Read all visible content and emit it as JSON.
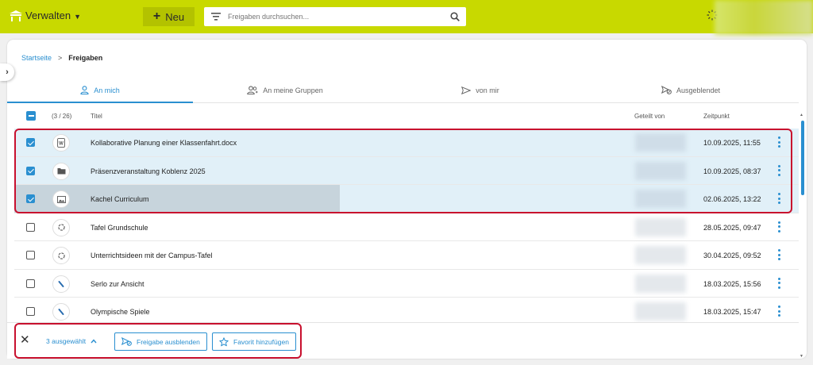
{
  "topbar": {
    "manage_label": "Verwalten",
    "new_label": "Neu",
    "search_placeholder": "Freigaben durchsuchen...",
    "colors": {
      "bar": "#c8d900",
      "new_button": "#b3c200"
    }
  },
  "breadcrumb": {
    "home": "Startseite",
    "current": "Freigaben"
  },
  "tabs": [
    {
      "label": "An mich",
      "icon": "person-icon",
      "active": true
    },
    {
      "label": "An meine Gruppen",
      "icon": "group-icon",
      "active": false
    },
    {
      "label": "von mir",
      "icon": "send-icon",
      "active": false
    },
    {
      "label": "Ausgeblendet",
      "icon": "hidden-share-icon",
      "active": false
    }
  ],
  "table": {
    "count": "(3 / 26)",
    "col_title": "Titel",
    "col_shared_by": "Geteilt von",
    "col_time": "Zeitpunkt",
    "rows": [
      {
        "title": "Kollaborative Planung einer Klassenfahrt.docx",
        "time": "10.09.2025, 11:55",
        "icon": "word-document-icon",
        "selected": true
      },
      {
        "title": "Präsenzveranstaltung Koblenz 2025",
        "time": "10.09.2025, 08:37",
        "icon": "folder-icon",
        "selected": true
      },
      {
        "title": "Kachel Curriculum",
        "time": "02.06.2025, 13:22",
        "icon": "image-icon",
        "selected": true
      },
      {
        "title": "Tafel Grundschule",
        "time": "28.05.2025, 09:47",
        "icon": "whiteboard-icon",
        "selected": false
      },
      {
        "title": "Unterrichtsideen mit der Campus-Tafel",
        "time": "30.04.2025, 09:52",
        "icon": "whiteboard-icon",
        "selected": false
      },
      {
        "title": "Serlo zur Ansicht",
        "time": "18.03.2025, 15:56",
        "icon": "link-icon",
        "selected": false
      },
      {
        "title": "Olympische Spiele",
        "time": "18.03.2025, 15:47",
        "icon": "link-icon",
        "selected": false
      }
    ]
  },
  "action_bar": {
    "selected_label": "3 ausgewählt",
    "hide_label": "Freigabe ausblenden",
    "favorite_label": "Favorit hinzufügen"
  },
  "colors": {
    "accent": "#2a8fd0",
    "selected_row": "#e1f0f8",
    "highlight": "#c8102e"
  }
}
